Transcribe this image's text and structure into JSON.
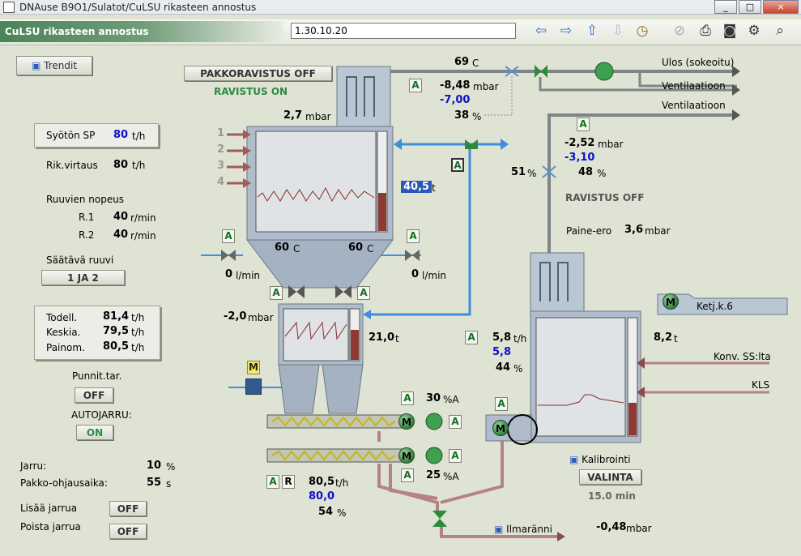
{
  "window": {
    "title": "DNAuse B9O1/Sulatot/CuLSU rikasteen annostus",
    "min": "_",
    "max": "□",
    "close": "×"
  },
  "header": {
    "title": "CuLSU rikasteen annostus",
    "time": "1.30.10.20"
  },
  "toolbar": {
    "icons": [
      "back-arrow-icon",
      "forward-arrow-icon",
      "up-arrow-icon",
      "down-arrow-icon",
      "clock-icon",
      "disabled-icon",
      "print-icon",
      "camera-icon",
      "settings-icon",
      "zoom-icon"
    ]
  },
  "left": {
    "trend_label": "Trendit",
    "feed_sp_label": "Syötön SP",
    "feed_sp_value": "80",
    "feed_sp_unit": "t/h",
    "rik_flow_label": "Rik.virtaus",
    "rik_flow_value": "80",
    "rik_flow_unit": "t/h",
    "screw_speed_label": "Ruuvien nopeus",
    "r1_label": "R.1",
    "r1_value": "40",
    "r1_unit": "r/min",
    "r2_label": "R.2",
    "r2_value": "40",
    "r2_unit": "r/min",
    "adjusting_screw_label": "Säätävä ruuvi",
    "adjusting_screw_value": "1 JA 2",
    "actual_label": "Todell.",
    "actual_value": "81,4",
    "actual_unit": "t/h",
    "avg_label": "Keskia.",
    "avg_value": "79,5",
    "avg_unit": "t/h",
    "weighted_label": "Painom.",
    "weighted_value": "80,5",
    "weighted_unit": "t/h",
    "punnit_label": "Punnit.tar.",
    "punnit_value": "OFF",
    "autojarru_label": "AUTOJARRU:",
    "autojarru_value": "ON",
    "jarru_label": "Jarru:",
    "jarru_value": "10",
    "jarru_unit": "%",
    "pakko_label": "Pakko-ohjausaika:",
    "pakko_value": "55",
    "pakko_unit": "s",
    "lisaa_label": "Lisää jarrua",
    "lisaa_value": "OFF",
    "poista_label": "Poista jarrua",
    "poista_value": "OFF"
  },
  "process": {
    "pakko_ravistus": "PAKKORAVISTUS OFF",
    "ravistus_on": "RAVISTUS ON",
    "top_pressure": "2,7",
    "top_pressure_unit": "mbar",
    "inlets": [
      "1",
      "2",
      "3",
      "4"
    ],
    "silo_weight": "40,5",
    "silo_weight_unit": "t",
    "temp_left": "60",
    "temp_right": "60",
    "temp_unit": "C",
    "flow_left": "0",
    "flow_right": "0",
    "flow_unit": "l/min",
    "hopper_pressure": "-2,0",
    "hopper_pressure_unit": "mbar",
    "hopper_weight": "21,0",
    "hopper_weight_unit": "t",
    "screw1_pct": "30",
    "screw1_unit": "%A",
    "screw2_pct": "25",
    "screw2_unit": "%A",
    "out_flow": "80,5",
    "out_flow_unit": "t/h",
    "out_sp": "80,0",
    "out_pct": "54",
    "out_pct_unit": "%",
    "temp_top": "69",
    "temp_top_unit": "C",
    "p1": "-8,48",
    "p1_unit": "mbar",
    "p1_sp": "-7,00",
    "p1_pct": "38",
    "p1_pct_unit": "%",
    "ulos_label": "Ulos (sokeoitu)",
    "vent1_label": "Ventilaatioon",
    "vent2_label": "Ventilaatioon",
    "p2": "-2,52",
    "p2_unit": "mbar",
    "p2_sp": "-3,10",
    "p2_pct": "48",
    "p2_pct_unit": "%",
    "valve2_pct": "51",
    "valve2_unit": "%",
    "ravistus_off": "RAVISTUS OFF",
    "paine_ero_label": "Paine-ero",
    "paine_ero_value": "3,6",
    "paine_ero_unit": "mbar",
    "ketju_label": "Ketj.k.6",
    "bin_flow": "5,8",
    "bin_flow_unit": "t/h",
    "bin_sp": "5,8",
    "bin_pct": "44",
    "bin_pct_unit": "%",
    "bin_weight": "8,2",
    "bin_weight_unit": "t",
    "konv_label": "Konv. SS:lta",
    "kls_label": "KLS",
    "kalibrointi_label": "Kalibrointi",
    "valinta_label": "VALINTA",
    "valinta_time": "15.0 min",
    "ilma_label": "Ilmaränni",
    "ilma_pressure": "-0,48",
    "ilma_unit": "mbar",
    "a_label": "A",
    "m_label": "M",
    "r_label": "R"
  }
}
